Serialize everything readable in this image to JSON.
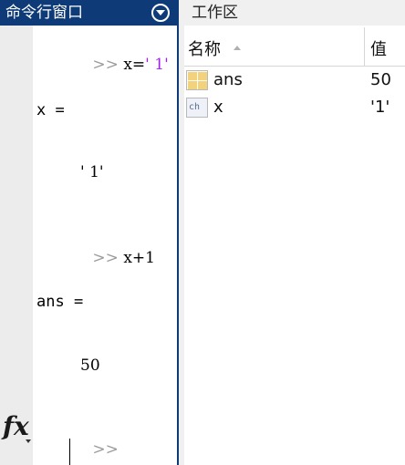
{
  "command_window": {
    "title": "命令行窗口",
    "prompt": ">>",
    "lines": [
      {
        "cmd_prefix": " x=",
        "cmd_string": "' 1'"
      },
      {
        "output": "x ="
      },
      {
        "output": "' 1'"
      },
      {
        "cmd": " x+1"
      },
      {
        "output": "ans ="
      },
      {
        "output": "50"
      }
    ]
  },
  "workspace": {
    "title": "工作区",
    "columns": {
      "name": "名称",
      "value": "值"
    },
    "variables": [
      {
        "name": "ans",
        "value": "50",
        "icon": "numeric-array-icon"
      },
      {
        "name": "x",
        "value": "'1'",
        "icon": "char-array-icon",
        "icon_text": "ch"
      }
    ]
  },
  "colors": {
    "accent": "#0e3b77",
    "string": "#a020f0",
    "prompt": "#9a9a9a"
  }
}
